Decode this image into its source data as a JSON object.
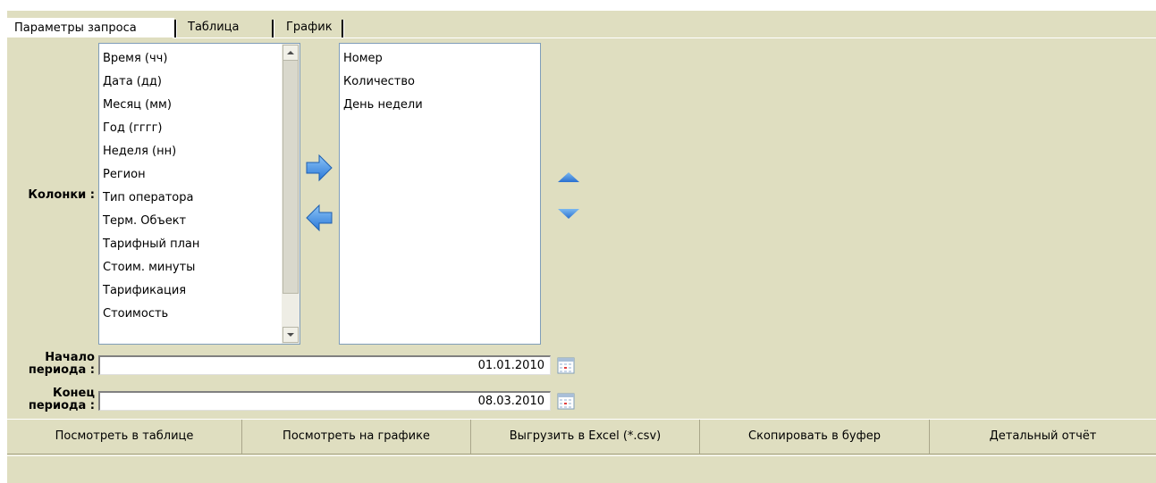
{
  "tabs": [
    {
      "label": "Параметры запроса",
      "active": true
    },
    {
      "label": "Таблица",
      "active": false
    },
    {
      "label": "График",
      "active": false
    }
  ],
  "columns_label": "Колонки :",
  "available_columns": [
    "Время (чч)",
    "Дата (дд)",
    "Месяц (мм)",
    "Год (гггг)",
    "Неделя (нн)",
    "Регион",
    "Тип оператора",
    "Терм. Объект",
    "Тарифный план",
    "Стоим. минуты",
    "Тарификация",
    "Стоимость"
  ],
  "selected_columns": [
    "Номер",
    "Количество",
    "День недели"
  ],
  "period_start": {
    "label_line1": "Начало",
    "label_line2": "периода :",
    "value": "01.01.2010"
  },
  "period_end": {
    "label_line1": "Конец",
    "label_line2": "периода :",
    "value": "08.03.2010"
  },
  "buttons": {
    "view_table": "Посмотреть в таблице",
    "view_chart": "Посмотреть на графике",
    "export_excel": "Выгрузить в Excel (*.csv)",
    "copy_buffer": "Скопировать в буфер",
    "detailed_report": "Детальный отчёт"
  },
  "colors": {
    "panel": "#dfdec0",
    "arrow_blue": "#3a8ee6"
  }
}
